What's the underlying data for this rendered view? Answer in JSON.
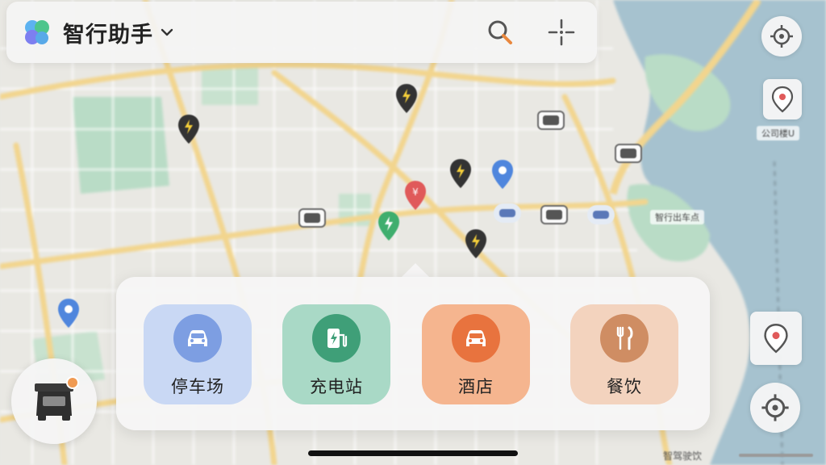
{
  "app": {
    "title": "智行助手"
  },
  "topbar": {
    "logo_icon": "app-logo-icon",
    "dropdown_icon": "chevron-down-icon",
    "search_icon": "search-icon",
    "locate_icon": "crosshair-icon"
  },
  "right_controls": {
    "compass_icon": "compass-icon",
    "marker_icon": "marker-icon",
    "navigate_icon": "navigate-icon"
  },
  "categories": [
    {
      "label": "停车场",
      "icon": "car-icon",
      "tile_color": "#c9d8f4",
      "circle_color": "#7d9ee2"
    },
    {
      "label": "充电站",
      "icon": "charging-station-icon",
      "tile_color": "#a9d9c6",
      "circle_color": "#3f9f78"
    },
    {
      "label": "酒店",
      "icon": "car-icon",
      "tile_color": "#f5b58f",
      "circle_color": "#e8733e"
    },
    {
      "label": "餐饮",
      "icon": "fork-knife-icon",
      "tile_color": "#f3d3be",
      "circle_color": "#cf8d63"
    }
  ],
  "map": {
    "labels": [
      "智行出车点",
      "公司楼U"
    ],
    "scale_text": "智驾驶饮"
  },
  "colors": {
    "water": "#a6c2cf",
    "park": "#b9dcc6",
    "road": "#f2d58e",
    "land": "#e9e8e3"
  }
}
